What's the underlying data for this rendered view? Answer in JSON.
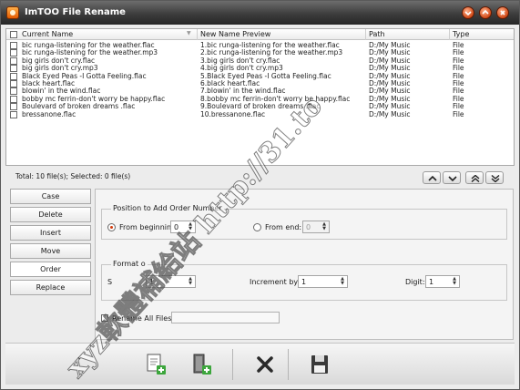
{
  "window": {
    "title": "ImTOO File Rename"
  },
  "grid": {
    "columns": [
      "Current Name",
      "New Name Preview",
      "Path",
      "Type"
    ],
    "rows": [
      {
        "current": "bic runga-listening for the weather.flac",
        "preview": "1.bic runga-listening for the weather.flac",
        "path": "D:/My Music",
        "type": "File"
      },
      {
        "current": "bic runga-listening for the weather.mp3",
        "preview": "2.bic runga-listening for the weather.mp3",
        "path": "D:/My Music",
        "type": "File"
      },
      {
        "current": "big girls don't cry.flac",
        "preview": "3.big girls don't cry.flac",
        "path": "D:/My Music",
        "type": "File"
      },
      {
        "current": "big girls don't cry.mp3",
        "preview": "4.big girls don't cry.mp3",
        "path": "D:/My Music",
        "type": "File"
      },
      {
        "current": "Black Eyed Peas -I Gotta Feeling.flac",
        "preview": "5.Black Eyed Peas -I Gotta Feeling.flac",
        "path": "D:/My Music",
        "type": "File"
      },
      {
        "current": "black heart.flac",
        "preview": "6.black heart.flac",
        "path": "D:/My Music",
        "type": "File"
      },
      {
        "current": "blowin' in the wind.flac",
        "preview": "7.blowin' in the wind.flac",
        "path": "D:/My Music",
        "type": "File"
      },
      {
        "current": "bobby mc ferrin-don't worry be happy.flac",
        "preview": "8.bobby mc ferrin-don't worry be happy.flac",
        "path": "D:/My Music",
        "type": "File"
      },
      {
        "current": "Boulevard of broken dreams .flac",
        "preview": "9.Boulevard of broken dreams .flac",
        "path": "D:/My Music",
        "type": "File"
      },
      {
        "current": "bressanone.flac",
        "preview": "10.bressanone.flac",
        "path": "D:/My Music",
        "type": "File"
      }
    ]
  },
  "status": {
    "text": "Total: 10 file(s); Selected: 0 file(s)"
  },
  "nav_buttons": [
    "move-up-icon",
    "move-down-icon",
    "move-top-icon",
    "move-bottom-icon"
  ],
  "tabs": [
    "Case",
    "Delete",
    "Insert",
    "Move",
    "Order",
    "Replace"
  ],
  "active_tab": "Order",
  "order": {
    "position_group": "Position to Add Order Number",
    "from_beginning_label": "From beginning:",
    "from_beginning_value": "0",
    "from_end_label": "From end:",
    "from_end_value": "0",
    "format_group": "Format o",
    "start_label": "S",
    "start_value": "1",
    "increment_label": "Increment by:",
    "increment_value": "1",
    "digit_label": "Digit:",
    "digit_value": "1",
    "rename_all_label": "Rename All Files to:",
    "rename_all_value": ""
  },
  "toolbar": {
    "buttons": [
      "add-file-icon",
      "add-folder-icon",
      "clear-icon",
      "save-icon"
    ]
  },
  "watermark": {
    "text": "xyz軟體補給站 http://31.to"
  },
  "colors": {
    "accent": "#d23c0e",
    "title_bar": "#3d3d3d",
    "add_green": "#3ca63c"
  }
}
